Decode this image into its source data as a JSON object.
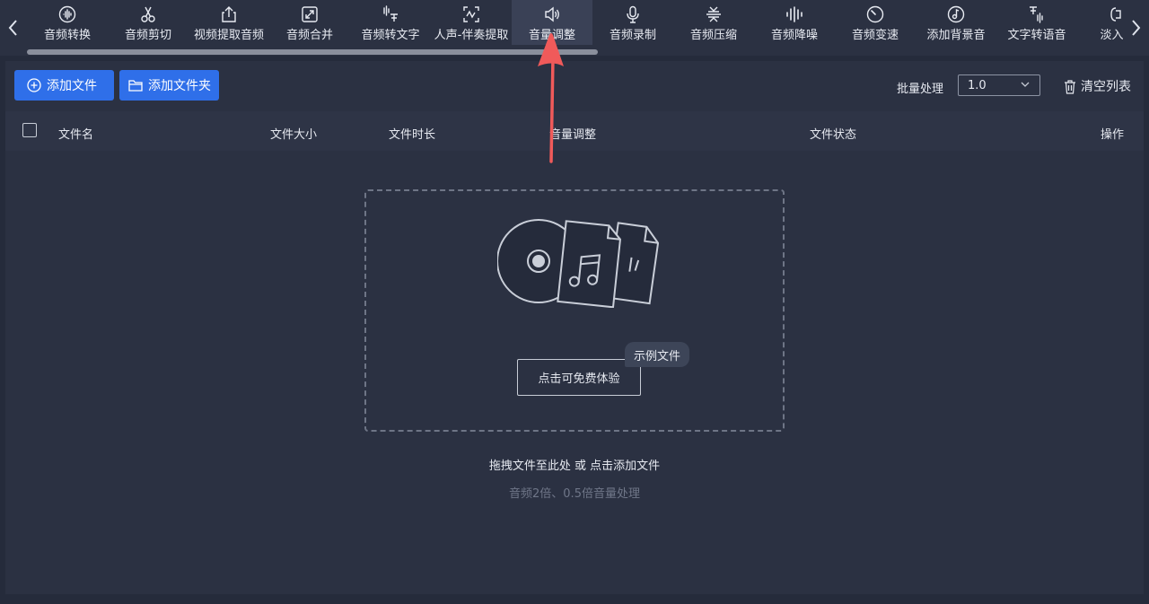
{
  "toolbar": {
    "tools": [
      {
        "icon": "audio-wave-icon",
        "label": "音频转换"
      },
      {
        "icon": "scissors-icon",
        "label": "音频剪切"
      },
      {
        "icon": "share-upload-icon",
        "label": "视频提取音频"
      },
      {
        "icon": "merge-arrows-icon",
        "label": "音频合并"
      },
      {
        "icon": "voice-to-text-icon",
        "label": "音频转文字"
      },
      {
        "icon": "vocal-separation-icon",
        "label": "人声-伴奏提取"
      },
      {
        "icon": "volume-speaker-icon",
        "label": "音量调整"
      },
      {
        "icon": "microphone-icon",
        "label": "音频录制"
      },
      {
        "icon": "compress-icon",
        "label": "音频压缩"
      },
      {
        "icon": "noise-bars-icon",
        "label": "音频降噪"
      },
      {
        "icon": "clock-speed-icon",
        "label": "音频变速"
      },
      {
        "icon": "music-note-circle-icon",
        "label": "添加背景音"
      },
      {
        "icon": "text-to-speech-icon",
        "label": "文字转语音"
      },
      {
        "icon": "fade-icon",
        "label": "淡入淡"
      }
    ],
    "active_index": 6
  },
  "actions": {
    "add_file": "添加文件",
    "add_folder": "添加文件夹",
    "batch_label": "批量处理",
    "batch_value": "1.0",
    "clear_list": "清空列表"
  },
  "table": {
    "columns": [
      "文件名",
      "文件大小",
      "文件时长",
      "音量调整",
      "文件状态",
      "操作"
    ]
  },
  "dropzone": {
    "try_button": "点击可免费体验",
    "sample_tag": "示例文件",
    "hint": "拖拽文件至此处 或 点击添加文件",
    "subhint": "音频2倍、0.5倍音量处理"
  },
  "colors": {
    "background": "#252b3b",
    "panel": "#2b3142",
    "primary": "#2f6fe9",
    "annotation_arrow": "#f05a5a"
  }
}
